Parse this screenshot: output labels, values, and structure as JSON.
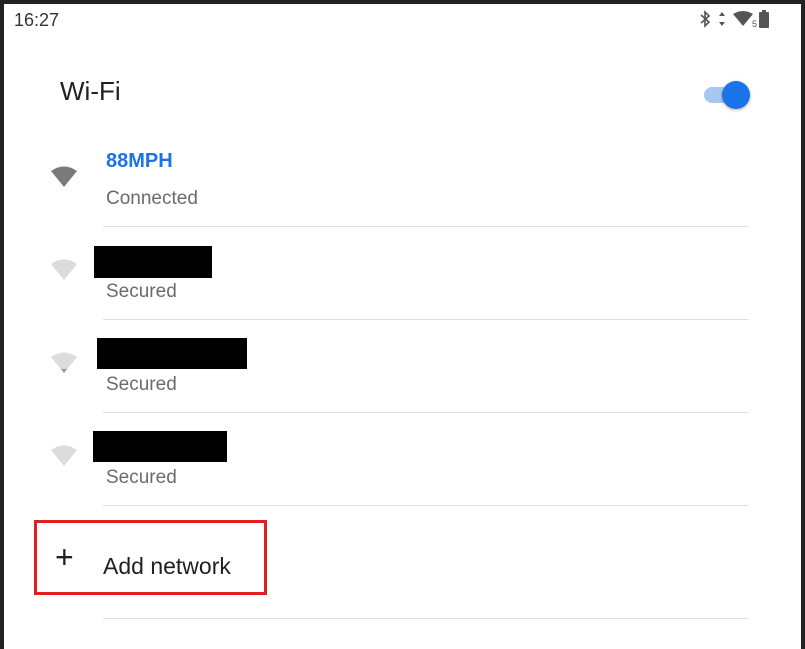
{
  "status_bar": {
    "time": "16:27",
    "icons": [
      "bluetooth-icon",
      "data-arrows-icon",
      "wifi-signal-icon",
      "battery-icon"
    ],
    "wifi_badge": "5"
  },
  "header": {
    "title": "Wi-Fi",
    "toggle_on": true,
    "accent_color": "#1a73e8"
  },
  "networks": [
    {
      "name": "88MPH",
      "status": "Connected",
      "redacted": false
    },
    {
      "name": "",
      "status": "Secured",
      "redacted": true
    },
    {
      "name": "",
      "status": "Secured",
      "redacted": true
    },
    {
      "name": "",
      "status": "Secured",
      "redacted": true
    }
  ],
  "add_network": {
    "icon": "plus-icon",
    "label": "Add network",
    "highlight_color": "#e02020"
  }
}
